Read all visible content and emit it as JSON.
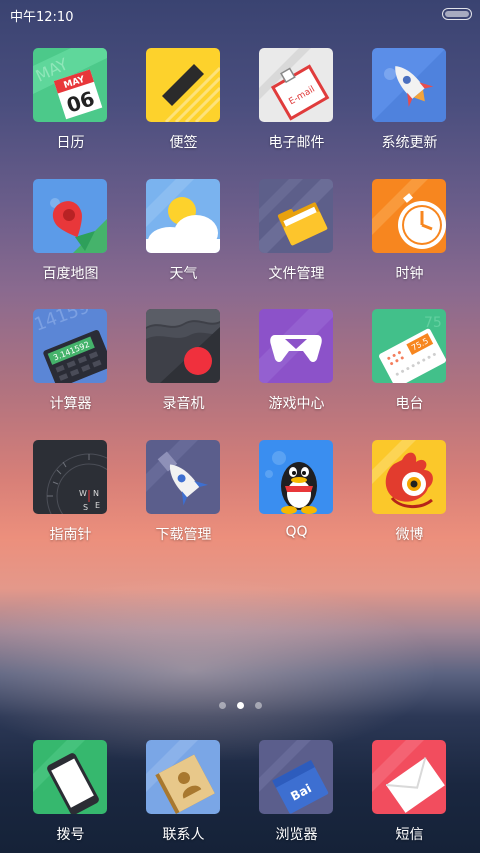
{
  "status_bar": {
    "time": "中午12:10"
  },
  "page_indicator": {
    "page_count": 3,
    "active_page": 2
  },
  "grid_apps": [
    {
      "label": "日历",
      "icon": "calendar-icon",
      "badge_text": [
        "MAY",
        "06"
      ]
    },
    {
      "label": "便签",
      "icon": "notes-icon"
    },
    {
      "label": "电子邮件",
      "icon": "email-icon",
      "badge_text": [
        "E-mail"
      ]
    },
    {
      "label": "系统更新",
      "icon": "rocket-update-icon"
    },
    {
      "label": "百度地图",
      "icon": "map-pin-icon"
    },
    {
      "label": "天气",
      "icon": "weather-sun-cloud-icon"
    },
    {
      "label": "文件管理",
      "icon": "folder-icon"
    },
    {
      "label": "时钟",
      "icon": "clock-icon"
    },
    {
      "label": "计算器",
      "icon": "calculator-icon",
      "badge_text": [
        "3.141592"
      ]
    },
    {
      "label": "录音机",
      "icon": "recorder-icon"
    },
    {
      "label": "游戏中心",
      "icon": "gamepad-icon"
    },
    {
      "label": "电台",
      "icon": "radio-icon",
      "badge_text": [
        "75.5"
      ]
    },
    {
      "label": "指南针",
      "icon": "compass-icon",
      "badge_text": [
        "W",
        "N",
        "E",
        "S"
      ]
    },
    {
      "label": "下载管理",
      "icon": "download-rocket-icon"
    },
    {
      "label": "QQ",
      "icon": "qq-penguin-icon"
    },
    {
      "label": "微博",
      "icon": "weibo-icon"
    }
  ],
  "dock_apps": [
    {
      "label": "拨号",
      "icon": "phone-dialer-icon"
    },
    {
      "label": "联系人",
      "icon": "contacts-book-icon"
    },
    {
      "label": "浏览器",
      "icon": "browser-icon",
      "badge_text": [
        "Bai"
      ]
    },
    {
      "label": "短信",
      "icon": "sms-envelope-icon"
    }
  ]
}
